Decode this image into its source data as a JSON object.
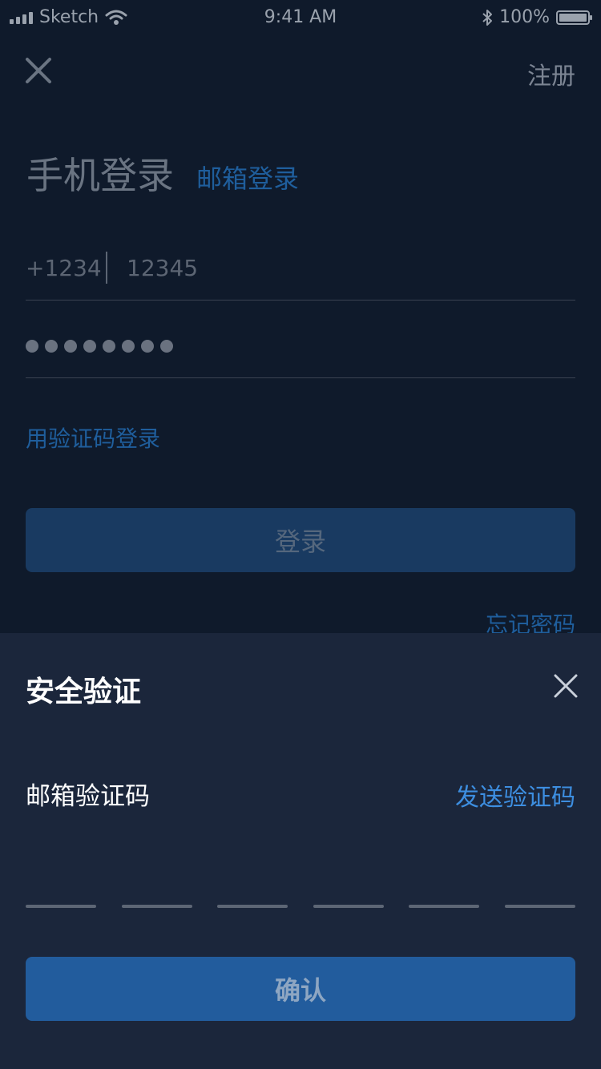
{
  "status_bar": {
    "carrier": "Sketch",
    "time": "9:41 AM",
    "battery": "100%"
  },
  "login": {
    "register": "注册",
    "title_phone": "手机登录",
    "title_email": "邮箱登录",
    "phone_prefix": "+1234",
    "phone_value": "12345",
    "password_masked_length": 8,
    "code_login": "用验证码登录",
    "login_button": "登录",
    "forgot_password": "忘记密码"
  },
  "sheet": {
    "title": "安全验证",
    "code_label": "邮箱验证码",
    "send_code": "发送验证码",
    "code_slots": 6,
    "confirm_button": "确认"
  },
  "colors": {
    "background": "#0f1a2b",
    "sheet_background": "#1b263b",
    "accent": "#3d8ee0",
    "button": "#225c9d"
  }
}
